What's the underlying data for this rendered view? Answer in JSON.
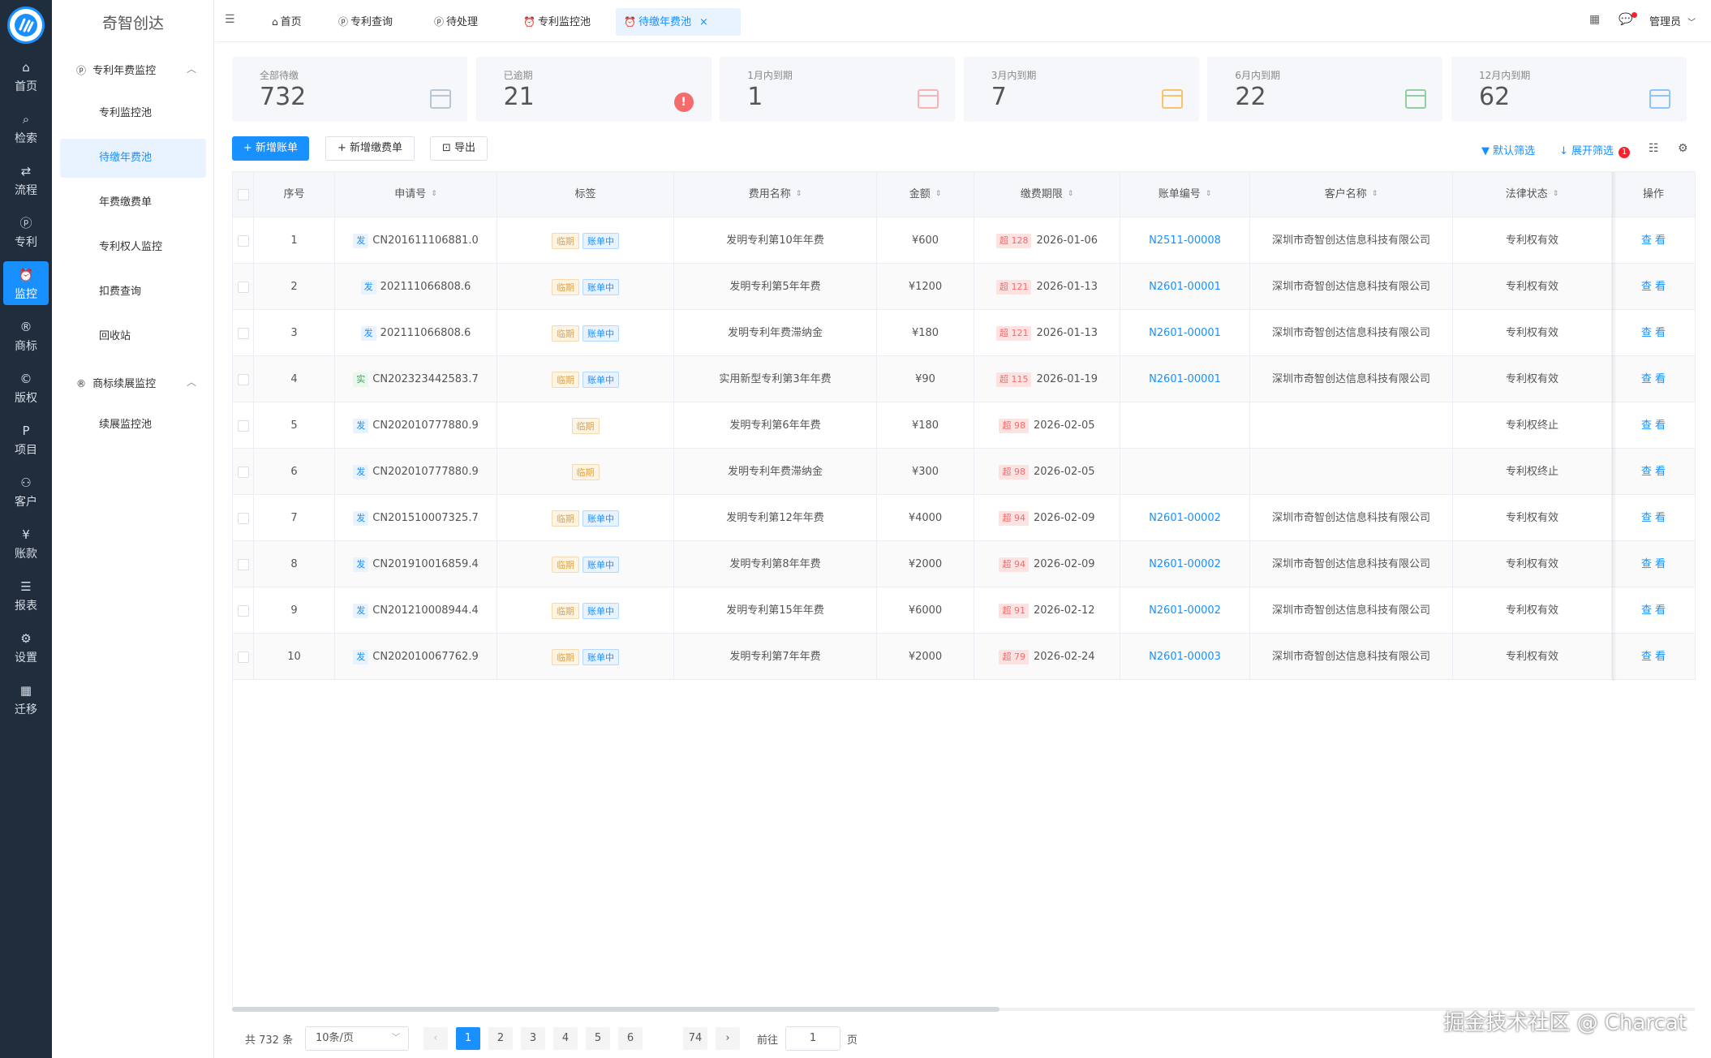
{
  "brand": "奇智创达",
  "rail": [
    {
      "icon": "⌂",
      "label": "首页",
      "name": "rail-home",
      "active": false
    },
    {
      "icon": "⌕",
      "label": "检索",
      "name": "rail-search",
      "active": false
    },
    {
      "icon": "⇄",
      "label": "流程",
      "name": "rail-flow",
      "active": false
    },
    {
      "icon": "ⓟ",
      "label": "专利",
      "name": "rail-patent",
      "active": false
    },
    {
      "icon": "⏰",
      "label": "监控",
      "name": "rail-monitor",
      "active": true
    },
    {
      "icon": "®",
      "label": "商标",
      "name": "rail-trademark",
      "active": false
    },
    {
      "icon": "©",
      "label": "版权",
      "name": "rail-copyright",
      "active": false
    },
    {
      "icon": "P",
      "label": "项目",
      "name": "rail-project",
      "active": false
    },
    {
      "icon": "⚇",
      "label": "客户",
      "name": "rail-customer",
      "active": false
    },
    {
      "icon": "¥",
      "label": "账款",
      "name": "rail-account",
      "active": false
    },
    {
      "icon": "☰",
      "label": "报表",
      "name": "rail-report",
      "active": false
    },
    {
      "icon": "⚙",
      "label": "设置",
      "name": "rail-settings",
      "active": false
    },
    {
      "icon": "▦",
      "label": "迁移",
      "name": "rail-migrate",
      "active": false
    }
  ],
  "menu": {
    "group1": "专利年费监控",
    "group2": "商标续展监控",
    "items1": [
      {
        "label": "专利监控池",
        "active": false
      },
      {
        "label": "待缴年费池",
        "active": true
      },
      {
        "label": "年费缴费单",
        "active": false
      },
      {
        "label": "专利权人监控",
        "active": false
      },
      {
        "label": "扣费查询",
        "active": false
      },
      {
        "label": "回收站",
        "active": false
      }
    ],
    "items2": [
      {
        "label": "续展监控池",
        "active": false
      }
    ]
  },
  "tabs": [
    {
      "icon": "⌂",
      "label": "首页",
      "active": false
    },
    {
      "icon": "ⓟ",
      "label": "专利查询",
      "active": false
    },
    {
      "icon": "ⓟ",
      "label": "待处理",
      "active": false
    },
    {
      "icon": "⏰",
      "label": "专利监控池",
      "active": false
    },
    {
      "icon": "⏰",
      "label": "待缴年费池",
      "active": true
    }
  ],
  "user": "管理员",
  "stats": [
    {
      "label": "全部待缴",
      "value": "732",
      "color": "#b9c6d3",
      "alert": false
    },
    {
      "label": "已逾期",
      "value": "21",
      "color": "#f56c6c",
      "alert": true
    },
    {
      "label": "1月内到期",
      "value": "1",
      "color": "#f7b4b4",
      "alert": false
    },
    {
      "label": "3月内到期",
      "value": "7",
      "color": "#f5c46b",
      "alert": false
    },
    {
      "label": "6月内到期",
      "value": "22",
      "color": "#8fd19e",
      "alert": false
    },
    {
      "label": "12月内到期",
      "value": "62",
      "color": "#8cc5ff",
      "alert": false
    }
  ],
  "toolbar": {
    "new_bill": "+ 新增账单",
    "new_fee": "+ 新增缴费单",
    "export": "⊡ 导出",
    "default_filter": "默认筛选",
    "expand_filter": "展开筛选",
    "filter_count": "1"
  },
  "columns": [
    "序号",
    "申请号",
    "标签",
    "费用名称",
    "金额",
    "缴费期限",
    "账单编号",
    "客户名称",
    "法律状态",
    "操作"
  ],
  "rows": [
    {
      "idx": "1",
      "type": "发",
      "app": "CN201611106881.0",
      "tags": [
        "临期",
        "账单中"
      ],
      "fee": "发明专利第10年年费",
      "amount": "¥600",
      "over": "超 128",
      "date": "2026-01-06",
      "bill": "N2511-00008",
      "customer": "深圳市奇智创达信息科技有限公司",
      "status": "专利权有效",
      "op": "查 看"
    },
    {
      "idx": "2",
      "type": "发",
      "app": "202111066808.6",
      "tags": [
        "临期",
        "账单中"
      ],
      "fee": "发明专利第5年年费",
      "amount": "¥1200",
      "over": "超 121",
      "date": "2026-01-13",
      "bill": "N2601-00001",
      "customer": "深圳市奇智创达信息科技有限公司",
      "status": "专利权有效",
      "op": "查 看"
    },
    {
      "idx": "3",
      "type": "发",
      "app": "202111066808.6",
      "tags": [
        "临期",
        "账单中"
      ],
      "fee": "发明专利年费滞纳金",
      "amount": "¥180",
      "over": "超 121",
      "date": "2026-01-13",
      "bill": "N2601-00001",
      "customer": "深圳市奇智创达信息科技有限公司",
      "status": "专利权有效",
      "op": "查 看"
    },
    {
      "idx": "4",
      "type": "实",
      "app": "CN202323442583.7",
      "tags": [
        "临期",
        "账单中"
      ],
      "fee": "实用新型专利第3年年费",
      "amount": "¥90",
      "over": "超 115",
      "date": "2026-01-19",
      "bill": "N2601-00001",
      "customer": "深圳市奇智创达信息科技有限公司",
      "status": "专利权有效",
      "op": "查 看"
    },
    {
      "idx": "5",
      "type": "发",
      "app": "CN202010777880.9",
      "tags": [
        "临期"
      ],
      "fee": "发明专利第6年年费",
      "amount": "¥180",
      "over": "超 98",
      "date": "2026-02-05",
      "bill": "",
      "customer": "",
      "status": "专利权终止",
      "op": "查 看"
    },
    {
      "idx": "6",
      "type": "发",
      "app": "CN202010777880.9",
      "tags": [
        "临期"
      ],
      "fee": "发明专利年费滞纳金",
      "amount": "¥300",
      "over": "超 98",
      "date": "2026-02-05",
      "bill": "",
      "customer": "",
      "status": "专利权终止",
      "op": "查 看"
    },
    {
      "idx": "7",
      "type": "发",
      "app": "CN201510007325.7",
      "tags": [
        "临期",
        "账单中"
      ],
      "fee": "发明专利第12年年费",
      "amount": "¥4000",
      "over": "超 94",
      "date": "2026-02-09",
      "bill": "N2601-00002",
      "customer": "深圳市奇智创达信息科技有限公司",
      "status": "专利权有效",
      "op": "查 看"
    },
    {
      "idx": "8",
      "type": "发",
      "app": "CN201910016859.4",
      "tags": [
        "临期",
        "账单中"
      ],
      "fee": "发明专利第8年年费",
      "amount": "¥2000",
      "over": "超 94",
      "date": "2026-02-09",
      "bill": "N2601-00002",
      "customer": "深圳市奇智创达信息科技有限公司",
      "status": "专利权有效",
      "op": "查 看"
    },
    {
      "idx": "9",
      "type": "发",
      "app": "CN201210008944.4",
      "tags": [
        "临期",
        "账单中"
      ],
      "fee": "发明专利第15年年费",
      "amount": "¥6000",
      "over": "超 91",
      "date": "2026-02-12",
      "bill": "N2601-00002",
      "customer": "深圳市奇智创达信息科技有限公司",
      "status": "专利权有效",
      "op": "查 看"
    },
    {
      "idx": "10",
      "type": "发",
      "app": "CN202010067762.9",
      "tags": [
        "临期",
        "账单中"
      ],
      "fee": "发明专利第7年年费",
      "amount": "¥2000",
      "over": "超 79",
      "date": "2026-02-24",
      "bill": "N2601-00003",
      "customer": "深圳市奇智创达信息科技有限公司",
      "status": "专利权有效",
      "op": "查 看"
    }
  ],
  "pagination": {
    "total": "共 732 条",
    "page_size": "10条/页",
    "pages": [
      "1",
      "2",
      "3",
      "4",
      "5",
      "6"
    ],
    "last": "74",
    "current": "1",
    "goto_label": "前往",
    "goto_value": "1",
    "page_unit": "页"
  },
  "watermark": "掘金技术社区 @ Charcat"
}
